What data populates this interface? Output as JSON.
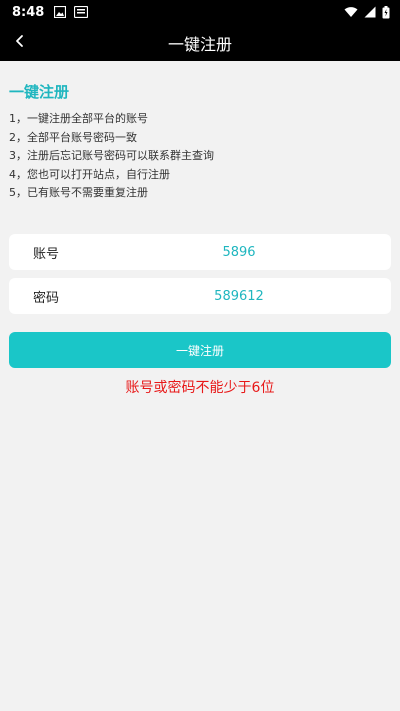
{
  "status_bar": {
    "time": "8:48",
    "left_icons": [
      "image-icon",
      "app-icon"
    ],
    "right_icons": [
      "wifi-icon",
      "signal-icon",
      "battery-icon"
    ]
  },
  "header": {
    "title": "一键注册",
    "back_icon": "chevron-left-icon"
  },
  "main": {
    "section_title": "一键注册",
    "instructions": [
      "1，一键注册全部平台的账号",
      "2，全部平台账号密码一致",
      "3，注册后忘记账号密码可以联系群主查询",
      "4，您也可以打开站点，自行注册",
      "5，已有账号不需要重复注册"
    ],
    "account": {
      "label": "账号",
      "value": "5896"
    },
    "password": {
      "label": "密码",
      "value": "589612"
    },
    "register_button_label": "一键注册",
    "error_message": "账号或密码不能少于6位"
  },
  "colors": {
    "accent": "#1ac6c8",
    "accent_text": "#1fb6bf",
    "error": "#e81818",
    "header_bg": "#000000",
    "page_bg": "#f2f2f2"
  }
}
